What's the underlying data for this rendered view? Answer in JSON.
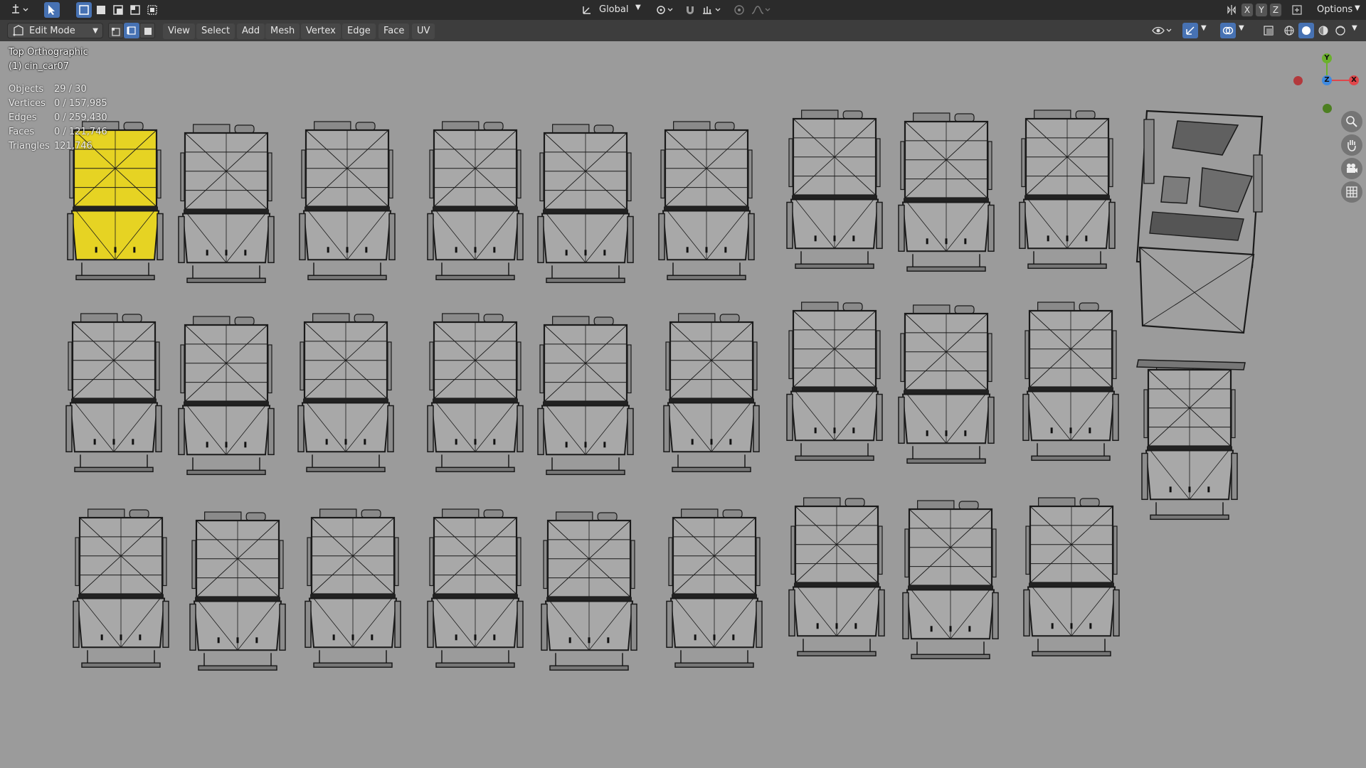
{
  "topbar": {
    "orientation_label": "Global",
    "options_label": "Options",
    "axis_x": "X",
    "axis_y": "Y",
    "axis_z": "Z"
  },
  "header": {
    "mode_label": "Edit Mode",
    "menus": [
      "View",
      "Select",
      "Add",
      "Mesh",
      "Vertex",
      "Edge",
      "Face",
      "UV"
    ]
  },
  "viewport": {
    "view_name": "Top Orthographic",
    "object_name": "(1) cin_car07",
    "stats": [
      {
        "label": "Objects",
        "value": "29 / 30"
      },
      {
        "label": "Vertices",
        "value": "0 / 157,985"
      },
      {
        "label": "Edges",
        "value": "0 / 259,430"
      },
      {
        "label": "Faces",
        "value": "0 / 121,746"
      },
      {
        "label": "Triangles",
        "value": "121,746"
      }
    ],
    "selected_color": "#e6d323",
    "mesh_color": "#a8a8a8",
    "wire_color": "#1a1a1a"
  },
  "gizmo": {
    "x": "X",
    "y": "Y",
    "z": "Z",
    "x_color": "#e0474b",
    "y_color": "#6bb12c",
    "z_color": "#3f8ae0"
  },
  "nav_tools": [
    "zoom-icon",
    "pan-hand-icon",
    "camera-icon",
    "grid-icon"
  ]
}
